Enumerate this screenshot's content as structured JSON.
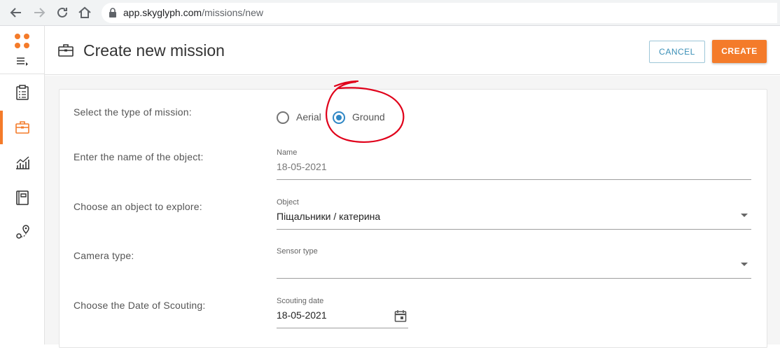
{
  "browser": {
    "url_host": "app.skyglyph.com",
    "url_path": "/missions/new",
    "icons": [
      "back-arrow-icon",
      "forward-arrow-icon",
      "reload-icon",
      "home-icon",
      "lock-icon"
    ]
  },
  "sidebar": {
    "items": [
      {
        "name": "clipboard-icon",
        "active": false
      },
      {
        "name": "briefcase-icon",
        "active": true
      },
      {
        "name": "analytics-chart-icon",
        "active": false
      },
      {
        "name": "notebook-icon",
        "active": false
      },
      {
        "name": "route-map-icon",
        "active": false
      }
    ]
  },
  "header": {
    "title": "Create new mission",
    "cancel_label": "CANCEL",
    "create_label": "CREATE"
  },
  "form": {
    "mission_type": {
      "label": "Select the type of mission:",
      "options": [
        "Aerial",
        "Ground"
      ],
      "selected": "Ground"
    },
    "object_name": {
      "label": "Enter the name of the object:",
      "field_label": "Name",
      "value": "18-05-2021"
    },
    "object": {
      "label": "Choose an object to explore:",
      "field_label": "Object",
      "value": "Піщальники / катерина"
    },
    "camera": {
      "label": "Camera type:",
      "field_label": "Sensor type",
      "value": ""
    },
    "scouting_date": {
      "label": "Choose the Date of Scouting:",
      "field_label": "Scouting date",
      "value": "18-05-2021"
    }
  },
  "colors": {
    "accent": "#f47b2a",
    "radio_selected": "#2f87c5",
    "cancel_text": "#3a8fb7",
    "annotation": "#e0001a"
  },
  "annotation": {
    "type": "hand-drawn circle",
    "target": "Ground"
  }
}
